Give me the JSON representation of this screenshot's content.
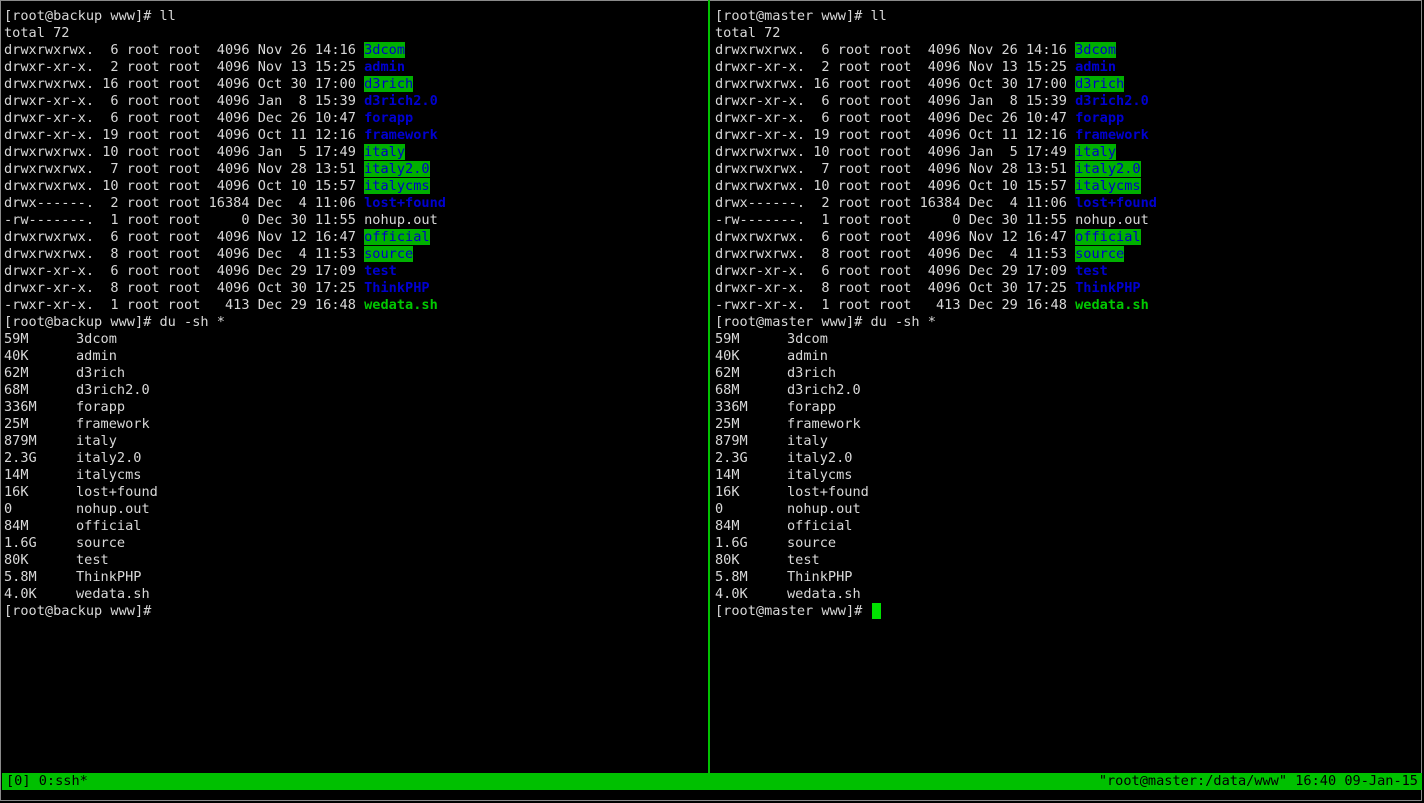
{
  "colors": {
    "background": "#000000",
    "text": "#d8d8d8",
    "accent_green": "#00c000",
    "dir_blue": "#0000d0",
    "exec_green": "#00c800"
  },
  "panes": [
    {
      "prompt_ll": "[root@backup www]# ll",
      "total": "total 72",
      "prompt_du": "[root@backup www]# du -sh *",
      "prompt_end": "[root@backup www]#"
    },
    {
      "prompt_ll": "[root@master www]# ll",
      "total": "total 72",
      "prompt_du": "[root@master www]# du -sh *",
      "prompt_end": "[root@master www]#"
    }
  ],
  "ls_entries": [
    {
      "perms": "drwxrwxrwx.",
      "links": " 6",
      "owner": "root",
      "group": "root",
      "size": " 4096",
      "date": "Nov 26 14:16",
      "name": "3dcom",
      "kind": "dir-sticky"
    },
    {
      "perms": "drwxr-xr-x.",
      "links": " 2",
      "owner": "root",
      "group": "root",
      "size": " 4096",
      "date": "Nov 13 15:25",
      "name": "admin",
      "kind": "dir"
    },
    {
      "perms": "drwxrwxrwx.",
      "links": "16",
      "owner": "root",
      "group": "root",
      "size": " 4096",
      "date": "Oct 30 17:00",
      "name": "d3rich",
      "kind": "dir-sticky"
    },
    {
      "perms": "drwxr-xr-x.",
      "links": " 6",
      "owner": "root",
      "group": "root",
      "size": " 4096",
      "date": "Jan  8 15:39",
      "name": "d3rich2.0",
      "kind": "dir"
    },
    {
      "perms": "drwxr-xr-x.",
      "links": " 6",
      "owner": "root",
      "group": "root",
      "size": " 4096",
      "date": "Dec 26 10:47",
      "name": "forapp",
      "kind": "dir"
    },
    {
      "perms": "drwxr-xr-x.",
      "links": "19",
      "owner": "root",
      "group": "root",
      "size": " 4096",
      "date": "Oct 11 12:16",
      "name": "framework",
      "kind": "dir"
    },
    {
      "perms": "drwxrwxrwx.",
      "links": "10",
      "owner": "root",
      "group": "root",
      "size": " 4096",
      "date": "Jan  5 17:49",
      "name": "italy",
      "kind": "dir-sticky"
    },
    {
      "perms": "drwxrwxrwx.",
      "links": " 7",
      "owner": "root",
      "group": "root",
      "size": " 4096",
      "date": "Nov 28 13:51",
      "name": "italy2.0",
      "kind": "dir-sticky"
    },
    {
      "perms": "drwxrwxrwx.",
      "links": "10",
      "owner": "root",
      "group": "root",
      "size": " 4096",
      "date": "Oct 10 15:57",
      "name": "italycms",
      "kind": "dir-sticky"
    },
    {
      "perms": "drwx------.",
      "links": " 2",
      "owner": "root",
      "group": "root",
      "size": "16384",
      "date": "Dec  4 11:06",
      "name": "lost+found",
      "kind": "dir"
    },
    {
      "perms": "-rw-------.",
      "links": " 1",
      "owner": "root",
      "group": "root",
      "size": "    0",
      "date": "Dec 30 11:55",
      "name": "nohup.out",
      "kind": "file"
    },
    {
      "perms": "drwxrwxrwx.",
      "links": " 6",
      "owner": "root",
      "group": "root",
      "size": " 4096",
      "date": "Nov 12 16:47",
      "name": "official",
      "kind": "dir-sticky"
    },
    {
      "perms": "drwxrwxrwx.",
      "links": " 8",
      "owner": "root",
      "group": "root",
      "size": " 4096",
      "date": "Dec  4 11:53",
      "name": "source",
      "kind": "dir-sticky"
    },
    {
      "perms": "drwxr-xr-x.",
      "links": " 6",
      "owner": "root",
      "group": "root",
      "size": " 4096",
      "date": "Dec 29 17:09",
      "name": "test",
      "kind": "dir"
    },
    {
      "perms": "drwxr-xr-x.",
      "links": " 8",
      "owner": "root",
      "group": "root",
      "size": " 4096",
      "date": "Oct 30 17:25",
      "name": "ThinkPHP",
      "kind": "dir"
    },
    {
      "perms": "-rwxr-xr-x.",
      "links": " 1",
      "owner": "root",
      "group": "root",
      "size": "  413",
      "date": "Dec 29 16:48",
      "name": "wedata.sh",
      "kind": "exec"
    }
  ],
  "du_entries": [
    {
      "size": "59M",
      "name": "3dcom"
    },
    {
      "size": "40K",
      "name": "admin"
    },
    {
      "size": "62M",
      "name": "d3rich"
    },
    {
      "size": "68M",
      "name": "d3rich2.0"
    },
    {
      "size": "336M",
      "name": "forapp"
    },
    {
      "size": "25M",
      "name": "framework"
    },
    {
      "size": "879M",
      "name": "italy"
    },
    {
      "size": "2.3G",
      "name": "italy2.0"
    },
    {
      "size": "14M",
      "name": "italycms"
    },
    {
      "size": "16K",
      "name": "lost+found"
    },
    {
      "size": "0",
      "name": "nohup.out"
    },
    {
      "size": "84M",
      "name": "official"
    },
    {
      "size": "1.6G",
      "name": "source"
    },
    {
      "size": "80K",
      "name": "test"
    },
    {
      "size": "5.8M",
      "name": "ThinkPHP"
    },
    {
      "size": "4.0K",
      "name": "wedata.sh"
    }
  ],
  "statusbar": {
    "left": "[0] 0:ssh*",
    "right": "\"root@master:/data/www\" 16:40 09-Jan-15"
  }
}
